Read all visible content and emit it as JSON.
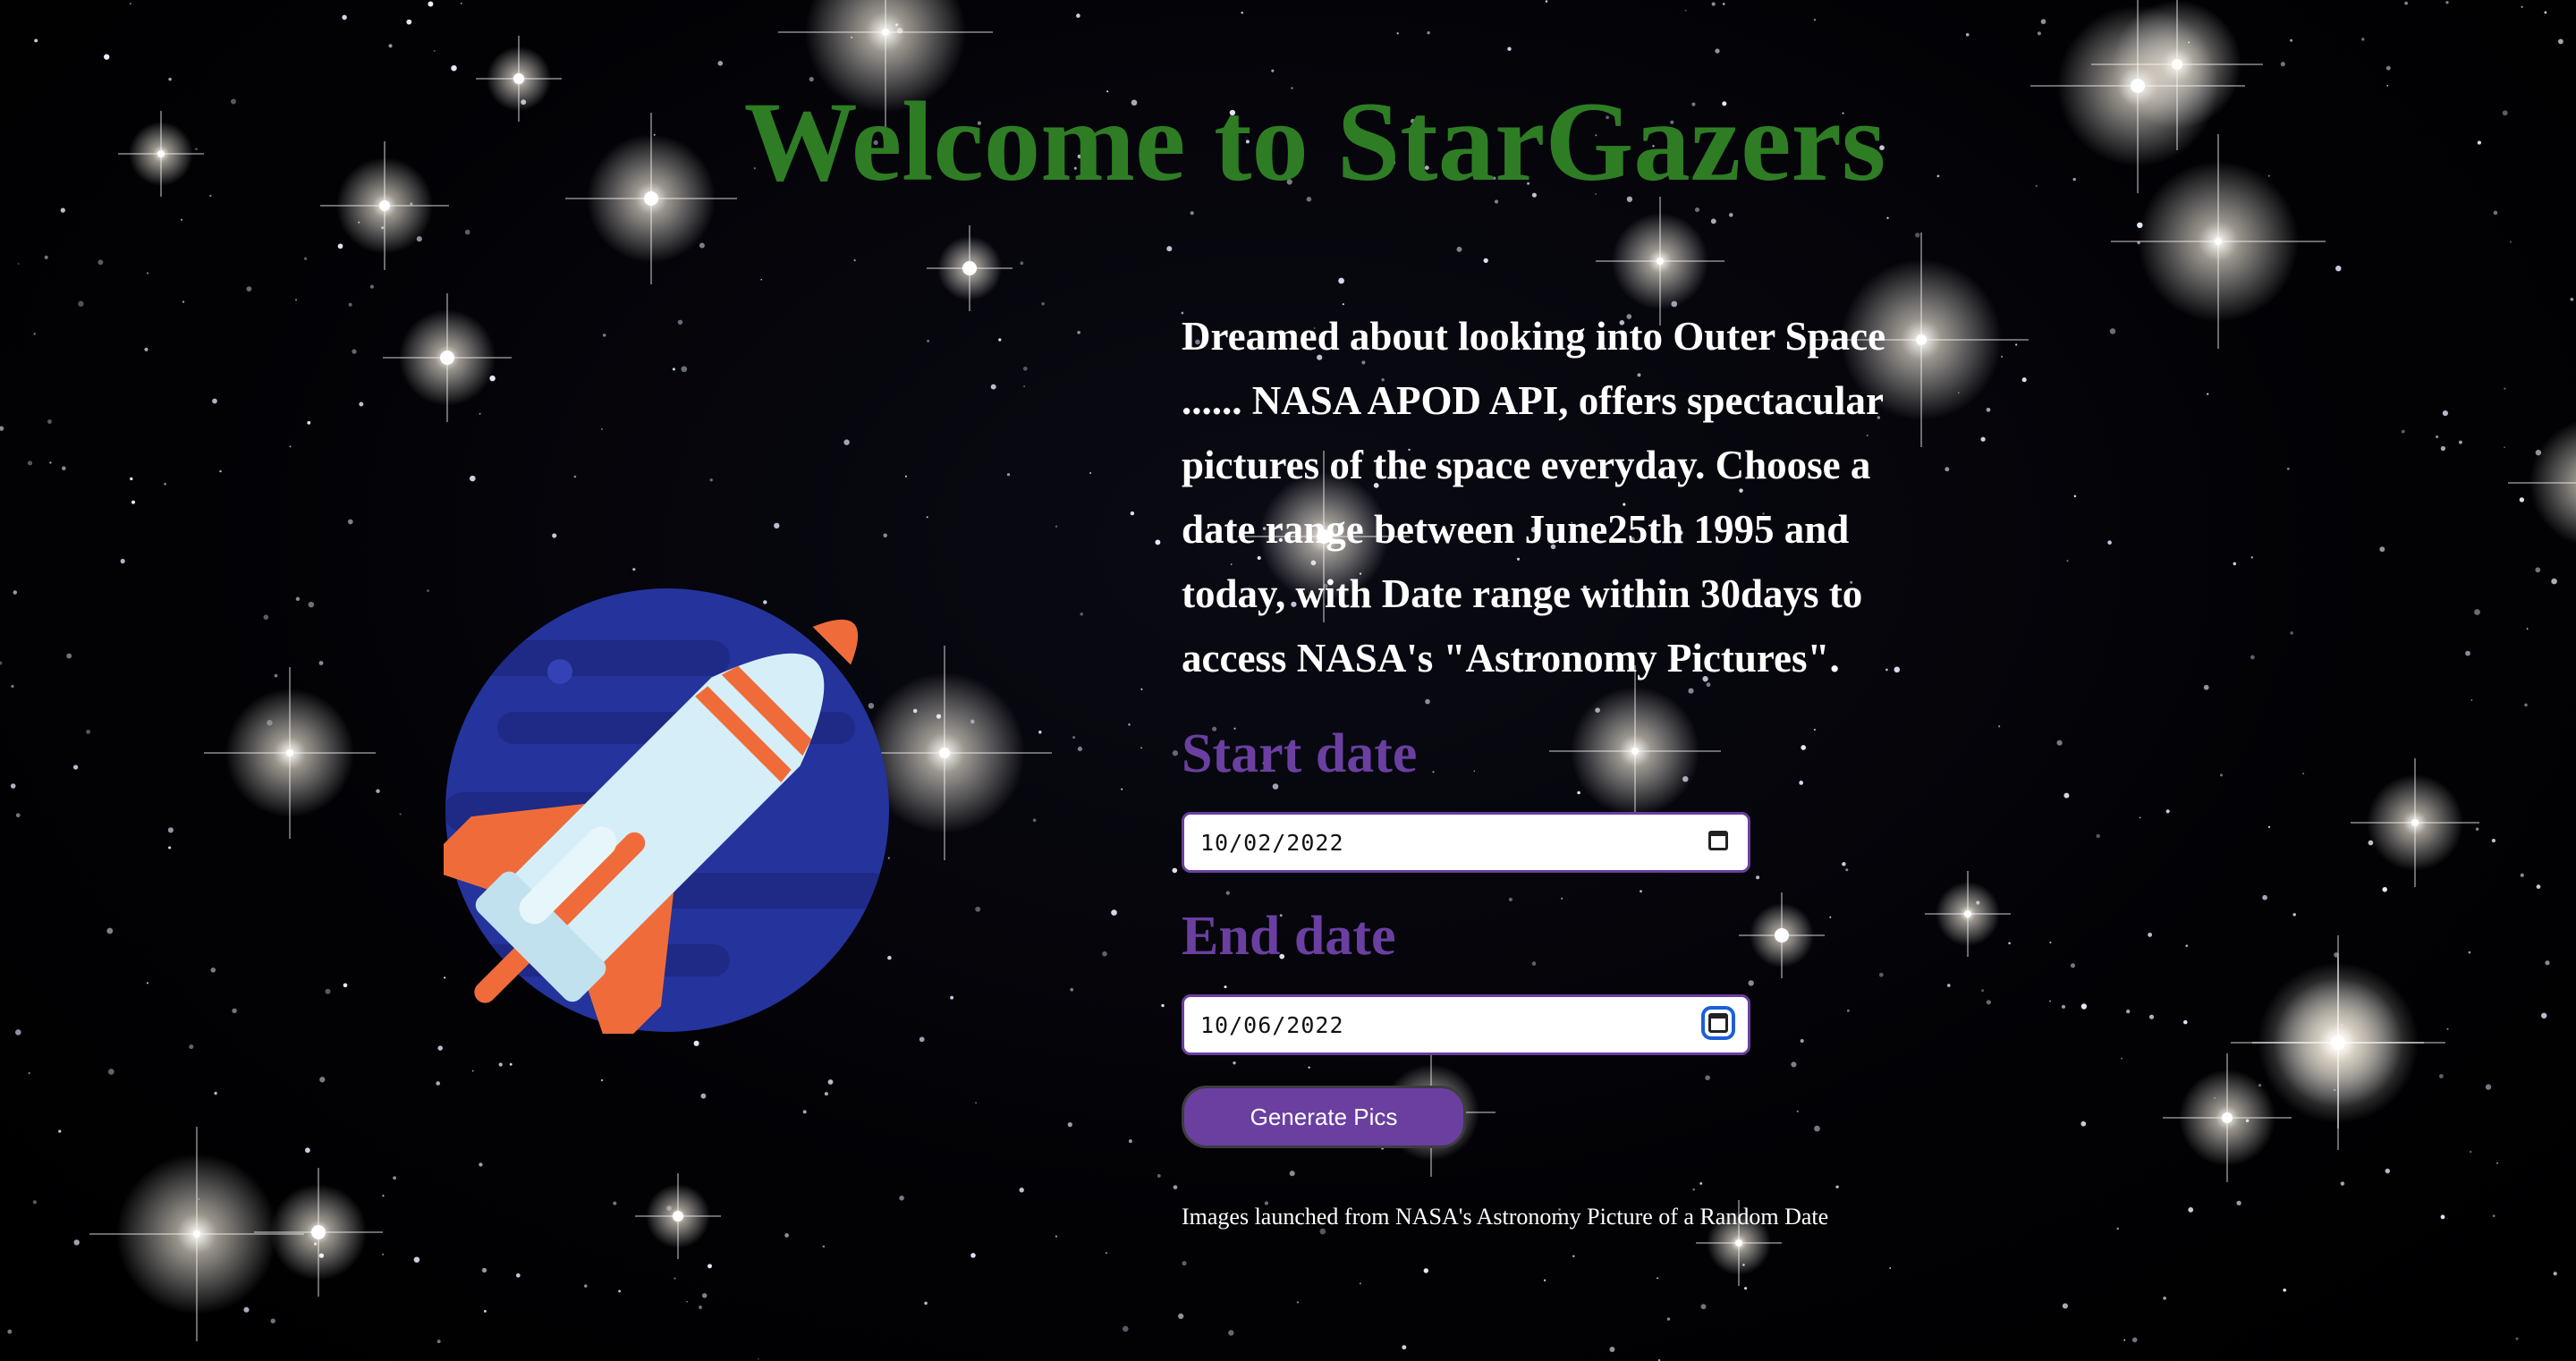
{
  "page": {
    "title": "Welcome to StarGazers",
    "intro": "Dreamed about looking into Outer Space ...... NASA APOD API, offers spectacular pictures of the space everyday. Choose a date range between June25th 1995 and today, with Date range within 30days to access NASA's \"Astronomy Pictures\".",
    "start_label": "Start date",
    "start_value": "10/02/2022",
    "end_label": "End date",
    "end_value": "10/06/2022",
    "generate_label": "Generate Pics",
    "footer_note": "Images launched from NASA's Astronomy Picture of a Random Date"
  },
  "colors": {
    "title": "#2e7d24",
    "label": "#6a3fa0",
    "button": "#6a3fa0",
    "planet": "#25339c",
    "rocket_body": "#d6eef7",
    "rocket_accent": "#ef6c3a"
  },
  "icons": [
    "rocket-planet-icon",
    "calendar-icon"
  ]
}
